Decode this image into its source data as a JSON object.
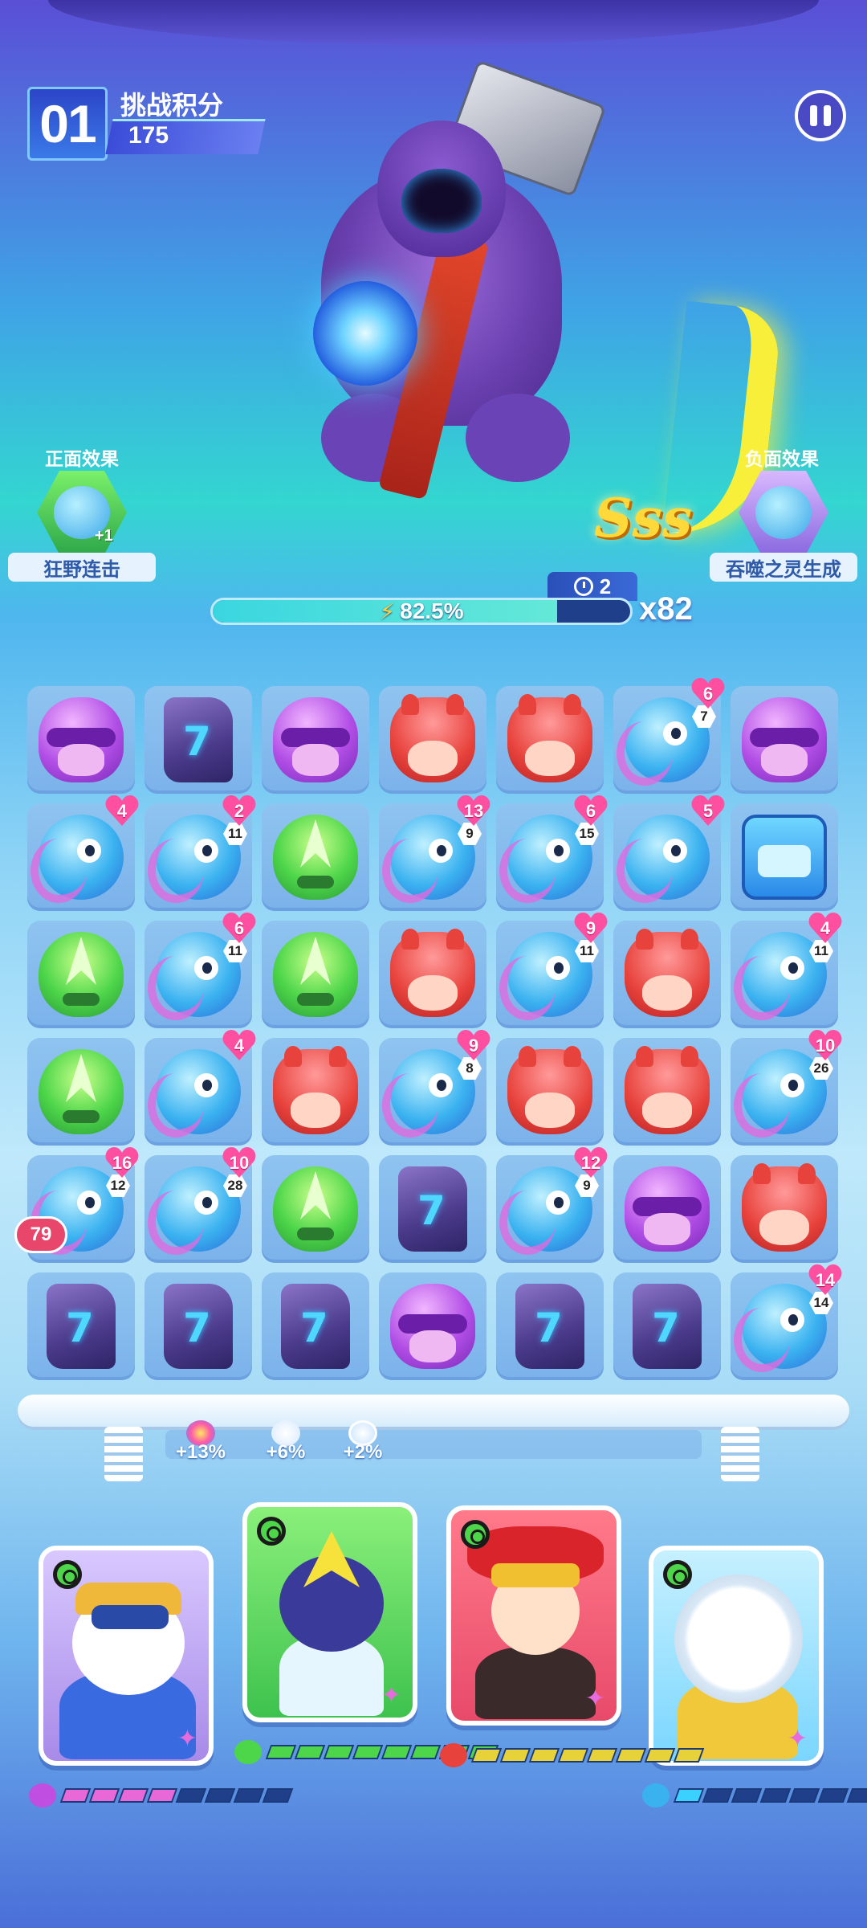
{
  "hud": {
    "round": "01",
    "score_title": "挑战积分",
    "score": "175"
  },
  "effects": {
    "positive_label": "正面效果",
    "positive_name": "狂野连击",
    "positive_bonus": "+1",
    "negative_label": "负面效果",
    "negative_name": "吞噬之灵生成"
  },
  "combo": {
    "rank": "Sss",
    "timer": "2",
    "energy_text": "82.5%",
    "energy_fraction": 0.825,
    "multiplier": "x82"
  },
  "side_counter": "79",
  "board": [
    [
      {
        "t": "purple"
      },
      {
        "t": "stone"
      },
      {
        "t": "purple"
      },
      {
        "t": "red"
      },
      {
        "t": "red"
      },
      {
        "t": "blue",
        "h": "6",
        "n": "7"
      },
      {
        "t": "purple"
      }
    ],
    [
      {
        "t": "blue",
        "h": "4"
      },
      {
        "t": "blue",
        "h": "2",
        "n": "11"
      },
      {
        "t": "green"
      },
      {
        "t": "blue",
        "h": "13",
        "n": "9"
      },
      {
        "t": "blue",
        "h": "6",
        "n": "15"
      },
      {
        "t": "blue",
        "h": "5"
      },
      {
        "t": "cube"
      }
    ],
    [
      {
        "t": "green"
      },
      {
        "t": "blue",
        "h": "6",
        "n": "11"
      },
      {
        "t": "green"
      },
      {
        "t": "red"
      },
      {
        "t": "blue",
        "h": "9",
        "n": "11"
      },
      {
        "t": "red"
      },
      {
        "t": "blue",
        "h": "4",
        "n": "11"
      }
    ],
    [
      {
        "t": "green"
      },
      {
        "t": "blue",
        "h": "4"
      },
      {
        "t": "red"
      },
      {
        "t": "blue",
        "h": "9",
        "n": "8"
      },
      {
        "t": "red"
      },
      {
        "t": "red"
      },
      {
        "t": "blue",
        "h": "10",
        "n": "26"
      }
    ],
    [
      {
        "t": "blue",
        "h": "16",
        "n": "12"
      },
      {
        "t": "blue",
        "h": "10",
        "n": "28"
      },
      {
        "t": "green"
      },
      {
        "t": "stone"
      },
      {
        "t": "blue",
        "h": "12",
        "n": "9"
      },
      {
        "t": "purple"
      },
      {
        "t": "red"
      }
    ],
    [
      {
        "t": "stone"
      },
      {
        "t": "stone"
      },
      {
        "t": "stone"
      },
      {
        "t": "purple"
      },
      {
        "t": "stone"
      },
      {
        "t": "stone"
      },
      {
        "t": "blue",
        "h": "14",
        "n": "14"
      }
    ]
  ],
  "bonuses": [
    {
      "text": "+13%",
      "icon": "rainbow-gem-icon"
    },
    {
      "text": "+6%",
      "icon": "bear-paw-icon"
    },
    {
      "text": "+2%",
      "icon": "swirl-icon"
    }
  ],
  "heroes": [
    {
      "name": "pilot-bear",
      "energy_filled": 4,
      "energy_total": 8,
      "color": "#e868d8"
    },
    {
      "name": "green-ranger",
      "energy_filled": 8,
      "energy_total": 8,
      "color": "#4ed64a"
    },
    {
      "name": "opera-mask",
      "energy_filled": 8,
      "energy_total": 8,
      "color": "#e8d23a"
    },
    {
      "name": "astronaut-bear",
      "energy_filled": 1,
      "energy_total": 8,
      "color": "#3ad0ff"
    }
  ],
  "colors": {
    "accent": "#33d6d0",
    "heart": "#ff4fa0",
    "sss": "#ffd93a"
  }
}
